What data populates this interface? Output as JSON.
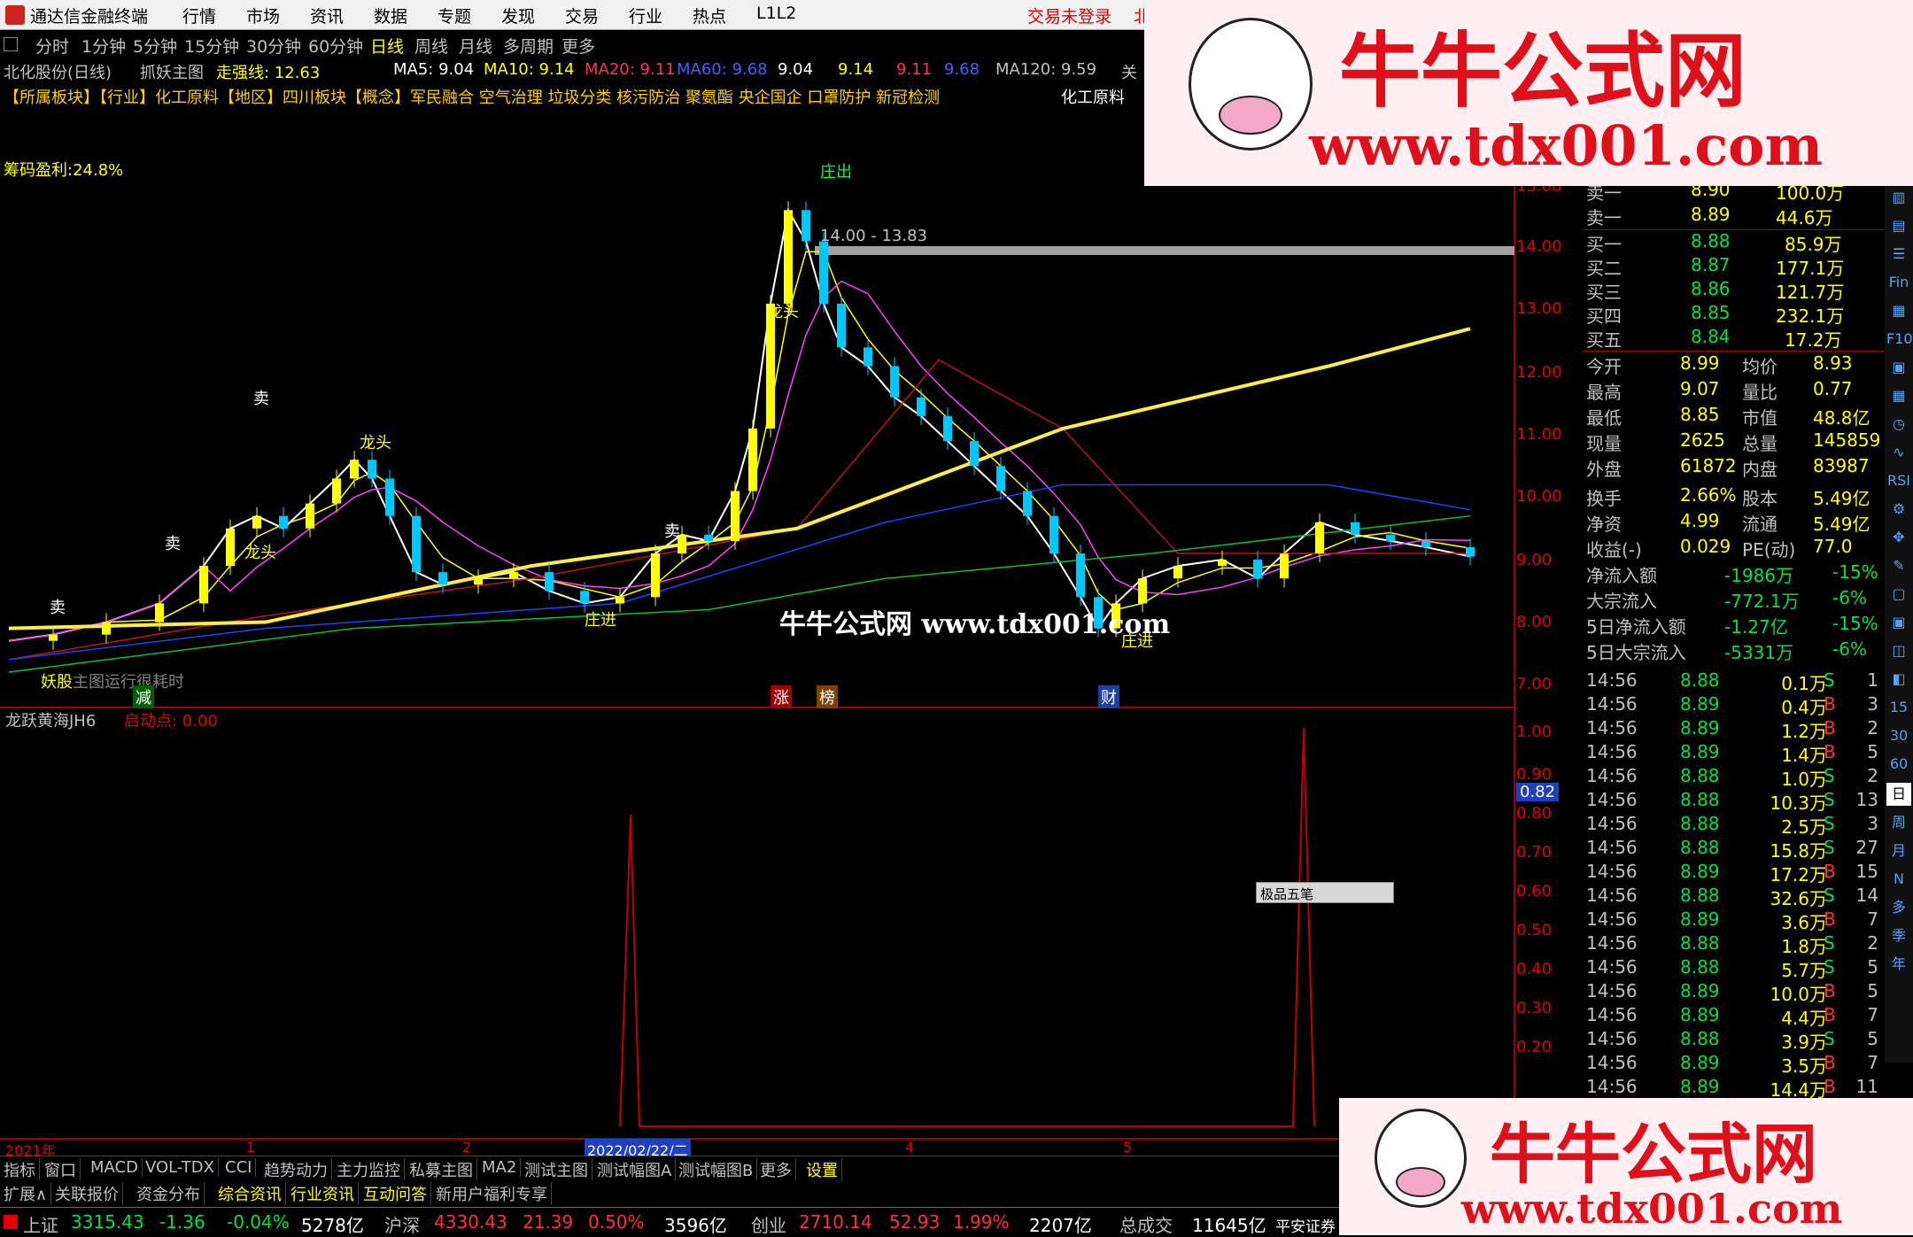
{
  "menubar": {
    "app_title": "通达信金融终端",
    "items": [
      "行情",
      "市场",
      "资讯",
      "数据",
      "专题",
      "发现",
      "交易",
      "行业",
      "热点",
      "L1L2"
    ],
    "status": "交易未登录",
    "status_extra": "北"
  },
  "periods": {
    "items": [
      "分时",
      "1分钟",
      "5分钟",
      "15分钟",
      "30分钟",
      "60分钟",
      "日线",
      "周线",
      "月线",
      "多周期",
      "更多"
    ],
    "active": "日线"
  },
  "info": {
    "stock": "北化股份(日线)",
    "formula": "抓妖主图",
    "strong_line": "走强线: 12.63",
    "ma5": "MA5: 9.04",
    "ma10": "MA10: 9.14",
    "ma20": "MA20: 9.11",
    "ma60": "MA60: 9.68",
    "v1": "9.04",
    "v2": "9.14",
    "v3": "9.11",
    "v4": "9.68",
    "ma120": "MA120: 9.59",
    "extra": "关"
  },
  "concepts": "【所属板块】【行业】化工原料【地区】四川板块【概念】军民融合 空气治理 垃圾分类 核污防治 聚氨酯 央企国企 口罩防护 新冠检测",
  "industry_label": "化工原料",
  "chart": {
    "chip_profit": "筹码盈利:24.8%",
    "range_label": "14.00 - 13.83",
    "y_ticks": [
      "15.00",
      "14.00",
      "13.00",
      "12.00",
      "11.00",
      "10.00",
      "9.00",
      "8.00",
      "7.00"
    ],
    "labels": {
      "sell1": "卖",
      "sell2": "卖",
      "sell3": "卖",
      "sell4": "卖",
      "long1": "龙头",
      "long2": "龙头",
      "long3": "龙头",
      "zhuangchu": "庄出",
      "zhuangjin1": "庄进",
      "zhuangjin2": "庄进",
      "yao": "妖股",
      "jian": "减",
      "zhang": "涨",
      "bang": "榜",
      "cai": "财",
      "slow": "主图运行很耗时"
    }
  },
  "sub": {
    "title": "龙跃黄海JH6",
    "trigger": "启动点: 0.00",
    "y_ticks": [
      "1.00",
      "0.90",
      "0.80",
      "0.70",
      "0.60",
      "0.50",
      "0.40",
      "0.30",
      "0.20"
    ],
    "current": "0.82"
  },
  "xaxis": {
    "year": "2021年",
    "m1": "1",
    "m2": "2",
    "date": "2022/02/22/二",
    "m4": "4",
    "m5": "5"
  },
  "orderbook": {
    "sell": [
      {
        "label": "卖一",
        "price": "8.90",
        "vol": "100.0万"
      },
      {
        "label": "卖一",
        "price": "8.89",
        "vol": "44.6万"
      }
    ],
    "buy": [
      {
        "label": "买一",
        "price": "8.88",
        "vol": "85.9万"
      },
      {
        "label": "买二",
        "price": "8.87",
        "vol": "177.1万"
      },
      {
        "label": "买三",
        "price": "8.86",
        "vol": "121.7万"
      },
      {
        "label": "买四",
        "price": "8.85",
        "vol": "232.1万"
      },
      {
        "label": "买五",
        "price": "8.84",
        "vol": "17.2万"
      }
    ]
  },
  "stats": [
    {
      "l1": "今开",
      "v1": "8.99",
      "l2": "均价",
      "v2": "8.93"
    },
    {
      "l1": "最高",
      "v1": "9.07",
      "l2": "量比",
      "v2": "0.77"
    },
    {
      "l1": "最低",
      "v1": "8.85",
      "l2": "市值",
      "v2": "48.8亿"
    },
    {
      "l1": "现量",
      "v1": "2625",
      "l2": "总量",
      "v2": "145859"
    },
    {
      "l1": "外盘",
      "v1": "61872",
      "l2": "内盘",
      "v2": "83987"
    },
    {
      "l1": "换手",
      "v1": "2.66%",
      "l2": "股本",
      "v2": "5.49亿"
    },
    {
      "l1": "净资",
      "v1": "4.99",
      "l2": "流通",
      "v2": "5.49亿"
    },
    {
      "l1": "收益(-)",
      "v1": "0.029",
      "l2": "PE(动)",
      "v2": "77.0"
    }
  ],
  "flows": [
    {
      "label": "净流入额",
      "value": "-1986万",
      "pct": "-15%"
    },
    {
      "label": "大宗流入",
      "value": "-772.1万",
      "pct": "-6%"
    },
    {
      "label": "5日净流入额",
      "value": "-1.27亿",
      "pct": "-15%"
    },
    {
      "label": "5日大宗流入",
      "value": "-5331万",
      "pct": "-6%"
    }
  ],
  "ticks": [
    {
      "t": "14:56",
      "p": "8.88",
      "v": "0.1万",
      "d": "S",
      "n": "1"
    },
    {
      "t": "14:56",
      "p": "8.89",
      "v": "0.4万",
      "d": "B",
      "n": "3"
    },
    {
      "t": "14:56",
      "p": "8.89",
      "v": "1.2万",
      "d": "B",
      "n": "2"
    },
    {
      "t": "14:56",
      "p": "8.89",
      "v": "1.4万",
      "d": "B",
      "n": "5"
    },
    {
      "t": "14:56",
      "p": "8.88",
      "v": "1.0万",
      "d": "S",
      "n": "2"
    },
    {
      "t": "14:56",
      "p": "8.88",
      "v": "10.3万",
      "d": "S",
      "n": "13"
    },
    {
      "t": "14:56",
      "p": "8.88",
      "v": "2.5万",
      "d": "S",
      "n": "3"
    },
    {
      "t": "14:56",
      "p": "8.88",
      "v": "15.8万",
      "d": "S",
      "n": "27"
    },
    {
      "t": "14:56",
      "p": "8.89",
      "v": "17.2万",
      "d": "B",
      "n": "15"
    },
    {
      "t": "14:56",
      "p": "8.88",
      "v": "32.6万",
      "d": "S",
      "n": "14"
    },
    {
      "t": "14:56",
      "p": "8.89",
      "v": "3.6万",
      "d": "B",
      "n": "7"
    },
    {
      "t": "14:56",
      "p": "8.88",
      "v": "1.8万",
      "d": "S",
      "n": "2"
    },
    {
      "t": "14:56",
      "p": "8.88",
      "v": "5.7万",
      "d": "S",
      "n": "5"
    },
    {
      "t": "14:56",
      "p": "8.89",
      "v": "10.0万",
      "d": "B",
      "n": "5"
    },
    {
      "t": "14:56",
      "p": "8.89",
      "v": "4.4万",
      "d": "B",
      "n": "7"
    },
    {
      "t": "14:56",
      "p": "8.88",
      "v": "3.9万",
      "d": "S",
      "n": "5"
    },
    {
      "t": "14:56",
      "p": "8.89",
      "v": "3.5万",
      "d": "B",
      "n": "7"
    },
    {
      "t": "14:56",
      "p": "8.89",
      "v": "14.4万",
      "d": "B",
      "n": "11"
    }
  ],
  "tools": [
    "RSI",
    "Fin",
    "F10",
    "15",
    "30",
    "60",
    "日",
    "周",
    "月",
    "N",
    "多",
    "季",
    "年"
  ],
  "tabs1": [
    "指标",
    "窗口",
    "MACD",
    "VOL-TDX",
    "CCI",
    "趋势动力",
    "主力监控",
    "私募主图",
    "MA2",
    "测试主图",
    "测试幅图A",
    "测试幅图B",
    "更多",
    "设置"
  ],
  "tabs2": [
    "扩展∧",
    "关联报价",
    "资金分布",
    "综合资讯",
    "行业资讯",
    "互动问答",
    "新用户福利专享"
  ],
  "quotes": {
    "sh_name": "上证",
    "sh_val": "3315.43",
    "sh_chg": "-1.36",
    "sh_pct": "-0.04%",
    "sh_amt": "5278亿",
    "hs_name": "沪深",
    "hs_val": "4330.43",
    "hs_chg": "21.39",
    "hs_pct": "0.50%",
    "hs_amt": "3596亿",
    "cy_name": "创业",
    "cy_val": "2710.14",
    "cy_chg": "52.93",
    "cy_pct": "1.99%",
    "cy_amt": "2207亿",
    "total": "总成交",
    "total_val": "11645亿",
    "broker": "平安证券"
  },
  "ime": "极品五笔",
  "watermark": {
    "title": "牛牛公式网",
    "url": "www.tdx001.com",
    "center": "牛牛公式网 www.tdx001.com"
  }
}
